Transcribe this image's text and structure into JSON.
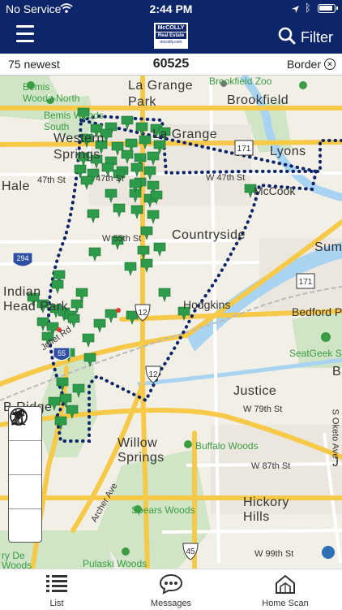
{
  "status_bar": {
    "carrier": "No Service",
    "time": "2:44 PM"
  },
  "header": {
    "logo_line1": "McCOLLY",
    "logo_line2": "Real Estate",
    "logo_url": "mccolly.com",
    "filter_label": "Filter"
  },
  "info_bar": {
    "count_label": "75 newest",
    "zip": "60525",
    "border_label": "Border"
  },
  "colors": {
    "header_bg": "#0d2569",
    "pin": "#2e9b4a",
    "boundary": "#0d2569",
    "highway": "#f7c948"
  },
  "map": {
    "places": {
      "la_grange_park": "La Grange\nPark",
      "brookfield": "Brookfield",
      "brookfield_zoo": "Brookfield Zoo",
      "western_springs": "Western\nSprings",
      "la_grange": "La Grange",
      "lyons": "Lyons",
      "hale": "Hale",
      "mccook": "McCook",
      "countryside": "Countryside",
      "sum": "Sum",
      "indian_head_park": "Indian\nHead Park",
      "hodgkins": "Hodgkins",
      "bedford_p": "Bedford P",
      "justice": "Justice",
      "willow_springs": "Willow\nSprings",
      "hickory_hills": "Hickory\nHills",
      "bemis_woods_north": "Bemis\nWoods-North",
      "bemis_woods_south": "Bemis Woods\nSouth",
      "seatgeek": "SeatGeek Sta",
      "buffalo_woods": "Buffalo Woods",
      "spears_woods": "Spears Woods",
      "pulaski_woods": "Pulaski Woods",
      "b_ridge": "B   Ridge",
      "b_right": "B",
      "j": "J",
      "woods_left": "Woods",
      "ry_de": "ry De"
    },
    "streets": {
      "47th": "47th St",
      "w47th": "W 47th St",
      "w55th": "W 55th St",
      "w79th": "W 79th St",
      "w87th": "W 87th St",
      "w99th": "W 99th St",
      "s_oketo": "S Oketo Ave",
      "archer": "Archer Ave",
      "joliet": "Joliet Rd"
    },
    "shields": [
      "12",
      "171",
      "294",
      "12",
      "55",
      "12",
      "171",
      "45"
    ],
    "listing_pin_count": 75
  },
  "tools": [
    "locate-icon",
    "draw-icon",
    "road-icon",
    "globe-icon"
  ],
  "tabs": [
    {
      "label": "List",
      "icon": "list-icon"
    },
    {
      "label": "Messages",
      "icon": "messages-icon"
    },
    {
      "label": "Home Scan",
      "icon": "home-scan-icon"
    }
  ]
}
